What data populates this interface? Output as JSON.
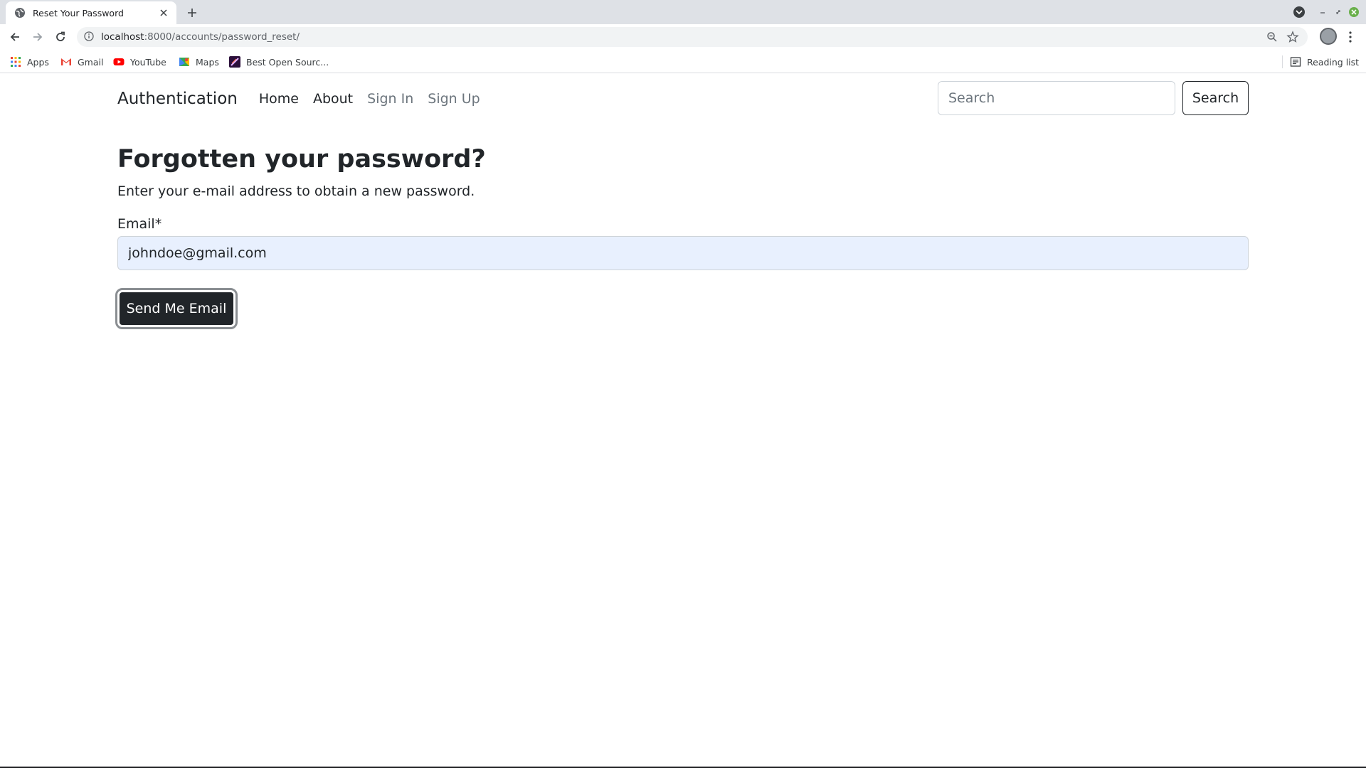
{
  "browser": {
    "tab_title": "Reset Your Password",
    "url_host": "localhost",
    "url_path": ":8000/accounts/password_reset/",
    "bookmarks": [
      {
        "label": "Apps",
        "icon": "apps-grid-icon"
      },
      {
        "label": "Gmail",
        "icon": "gmail-icon"
      },
      {
        "label": "YouTube",
        "icon": "youtube-icon"
      },
      {
        "label": "Maps",
        "icon": "maps-icon"
      },
      {
        "label": "Best Open Sourc...",
        "icon": "bookmark-site-icon"
      }
    ],
    "reading_list": "Reading list"
  },
  "navbar": {
    "brand": "Authentication",
    "links": [
      {
        "label": "Home",
        "state": "active"
      },
      {
        "label": "About",
        "state": "active"
      },
      {
        "label": "Sign In",
        "state": "muted"
      },
      {
        "label": "Sign Up",
        "state": "muted"
      }
    ],
    "search_placeholder": "Search",
    "search_button": "Search"
  },
  "form": {
    "heading": "Forgotten your password?",
    "subtitle": "Enter your e-mail address to obtain a new password.",
    "email_label": "Email*",
    "email_value": "johndoe@gmail.com",
    "submit_label": "Send Me Email"
  },
  "colors": {
    "accent_dark": "#212529",
    "muted_link": "#6c757d",
    "autofill_bg": "#e8f0fe"
  }
}
